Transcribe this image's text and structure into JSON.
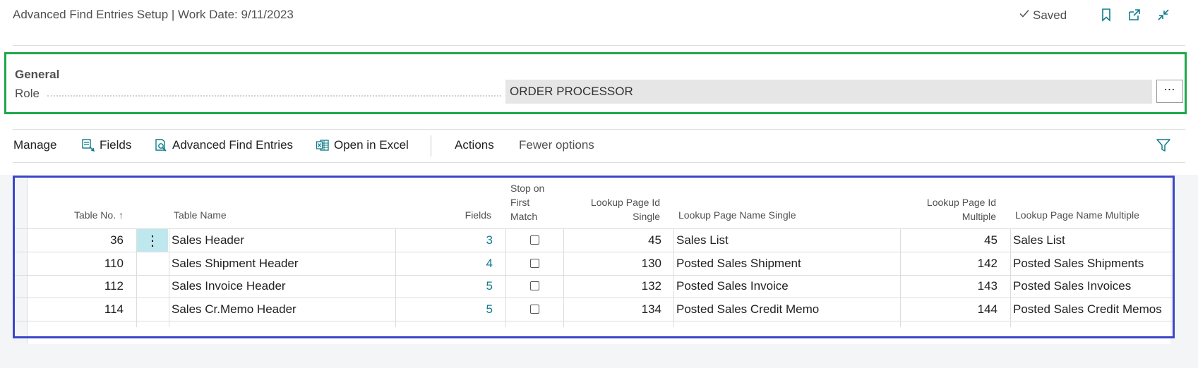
{
  "header": {
    "title": "Advanced Find Entries Setup | Work Date: 9/11/2023",
    "saved_label": "Saved",
    "icons": [
      "checkmark-icon",
      "bookmark-icon",
      "open-new-window-icon",
      "collapse-icon"
    ]
  },
  "general": {
    "section_label": "General",
    "role_label": "Role",
    "role_value": "ORDER PROCESSOR",
    "role_button": "⋯"
  },
  "actions": {
    "manage": "Manage",
    "fields": "Fields",
    "advanced_find_entries": "Advanced Find Entries",
    "open_in_excel": "Open in Excel",
    "actions": "Actions",
    "fewer_options": "Fewer options"
  },
  "table": {
    "columns": {
      "table_no": "Table No. ↑",
      "table_name": "Table Name",
      "fields": "Fields",
      "stop_line1": "Stop on",
      "stop_line2": "First",
      "stop_line3": "Match",
      "lookup_id_single_1": "Lookup Page Id",
      "lookup_id_single_2": "Single",
      "lookup_name_single": "Lookup Page Name Single",
      "lookup_id_multiple_1": "Lookup Page Id",
      "lookup_id_multiple_2": "Multiple",
      "lookup_name_multiple": "Lookup Page Name Multiple"
    },
    "row_menu": "⋮",
    "rows": [
      {
        "table_no": "36",
        "table_name": "Sales Header",
        "fields": "3",
        "stop_on_first_match": false,
        "lookup_id_single": "45",
        "lookup_name_single": "Sales List",
        "lookup_id_multiple": "45",
        "lookup_name_multiple": "Sales List"
      },
      {
        "table_no": "110",
        "table_name": "Sales Shipment Header",
        "fields": "4",
        "stop_on_first_match": false,
        "lookup_id_single": "130",
        "lookup_name_single": "Posted Sales Shipment",
        "lookup_id_multiple": "142",
        "lookup_name_multiple": "Posted Sales Shipments"
      },
      {
        "table_no": "112",
        "table_name": "Sales Invoice Header",
        "fields": "5",
        "stop_on_first_match": false,
        "lookup_id_single": "132",
        "lookup_name_single": "Posted Sales Invoice",
        "lookup_id_multiple": "143",
        "lookup_name_multiple": "Posted Sales Invoices"
      },
      {
        "table_no": "114",
        "table_name": "Sales Cr.Memo Header",
        "fields": "5",
        "stop_on_first_match": false,
        "lookup_id_single": "134",
        "lookup_name_single": "Posted Sales Credit Memo",
        "lookup_id_multiple": "144",
        "lookup_name_multiple": "Posted Sales Credit Memos"
      }
    ]
  },
  "colors": {
    "accent": "#0f7b8a",
    "general_highlight": "#1fa84a",
    "grid_highlight": "#3a46c8",
    "selected_cell": "#bfe8ee"
  }
}
